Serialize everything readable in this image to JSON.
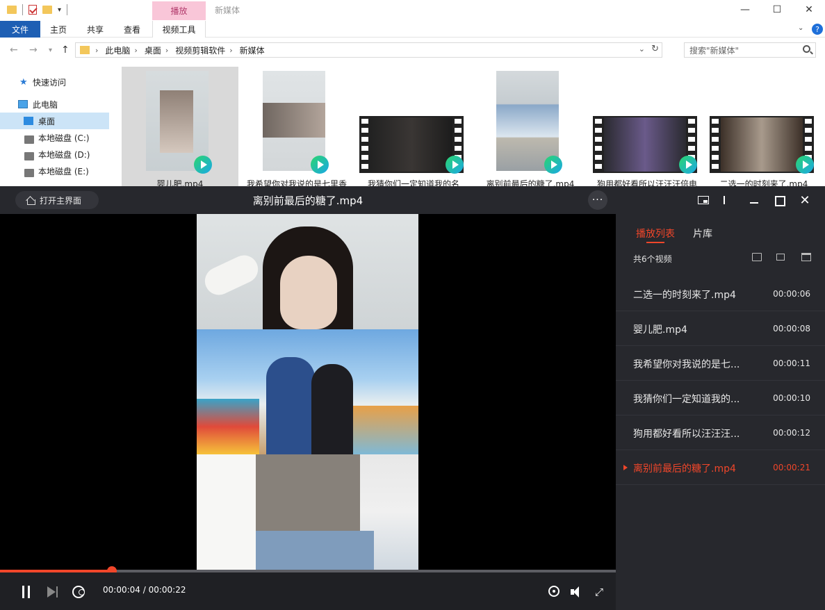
{
  "explorer": {
    "title": "新媒体",
    "context_tab_group": "播放",
    "ribbon_tabs": [
      "文件",
      "主页",
      "共享",
      "查看",
      "视频工具"
    ],
    "address": [
      "此电脑",
      "桌面",
      "视频剪辑软件",
      "新媒体"
    ],
    "search_placeholder": "搜索\"新媒体\"",
    "nav_items": [
      {
        "label": "快速访问",
        "icon": "star-icon"
      },
      {
        "label": "此电脑",
        "icon": "pc-icon"
      },
      {
        "label": "桌面",
        "icon": "desktop-icon",
        "selected": true
      },
      {
        "label": "本地磁盘 (C:)",
        "icon": "drive-icon"
      },
      {
        "label": "本地磁盘 (D:)",
        "icon": "drive-icon"
      },
      {
        "label": "本地磁盘 (E:)",
        "icon": "drive-icon"
      }
    ],
    "files": [
      {
        "name": "婴儿肥.mp4",
        "selected": true
      },
      {
        "name": "我希望你对我说的是七里香",
        "selected": false
      },
      {
        "name": "我猜你们一定知道我的名",
        "selected": false
      },
      {
        "name": "离别前最后的糖了.mp4",
        "selected": false
      },
      {
        "name": "狗用都好看所以汪汪汪倍电",
        "selected": false
      },
      {
        "name": "二选一的时刻来了.mp4",
        "selected": false
      }
    ]
  },
  "player": {
    "home_button": "打开主界面",
    "title": "离别前最后的糖了.mp4",
    "more_label": "···",
    "progress": 0.182,
    "time_text": "00:00:04 / 00:00:22",
    "tabs": [
      "播放列表",
      "片库"
    ],
    "count_text": "共6个视频",
    "playlist": [
      {
        "name": "二选一的时刻来了.mp4",
        "duration": "00:00:06",
        "current": false
      },
      {
        "name": "婴儿肥.mp4",
        "duration": "00:00:08",
        "current": false
      },
      {
        "name": "我希望你对我说的是七...",
        "duration": "00:00:11",
        "current": false
      },
      {
        "name": "我猜你们一定知道我的...",
        "duration": "00:00:10",
        "current": false
      },
      {
        "name": "狗用都好看所以汪汪汪...",
        "duration": "00:00:12",
        "current": false
      },
      {
        "name": "离别前最后的糖了.mp4",
        "duration": "00:00:21",
        "current": true
      }
    ],
    "accent_color": "#f0462a"
  }
}
